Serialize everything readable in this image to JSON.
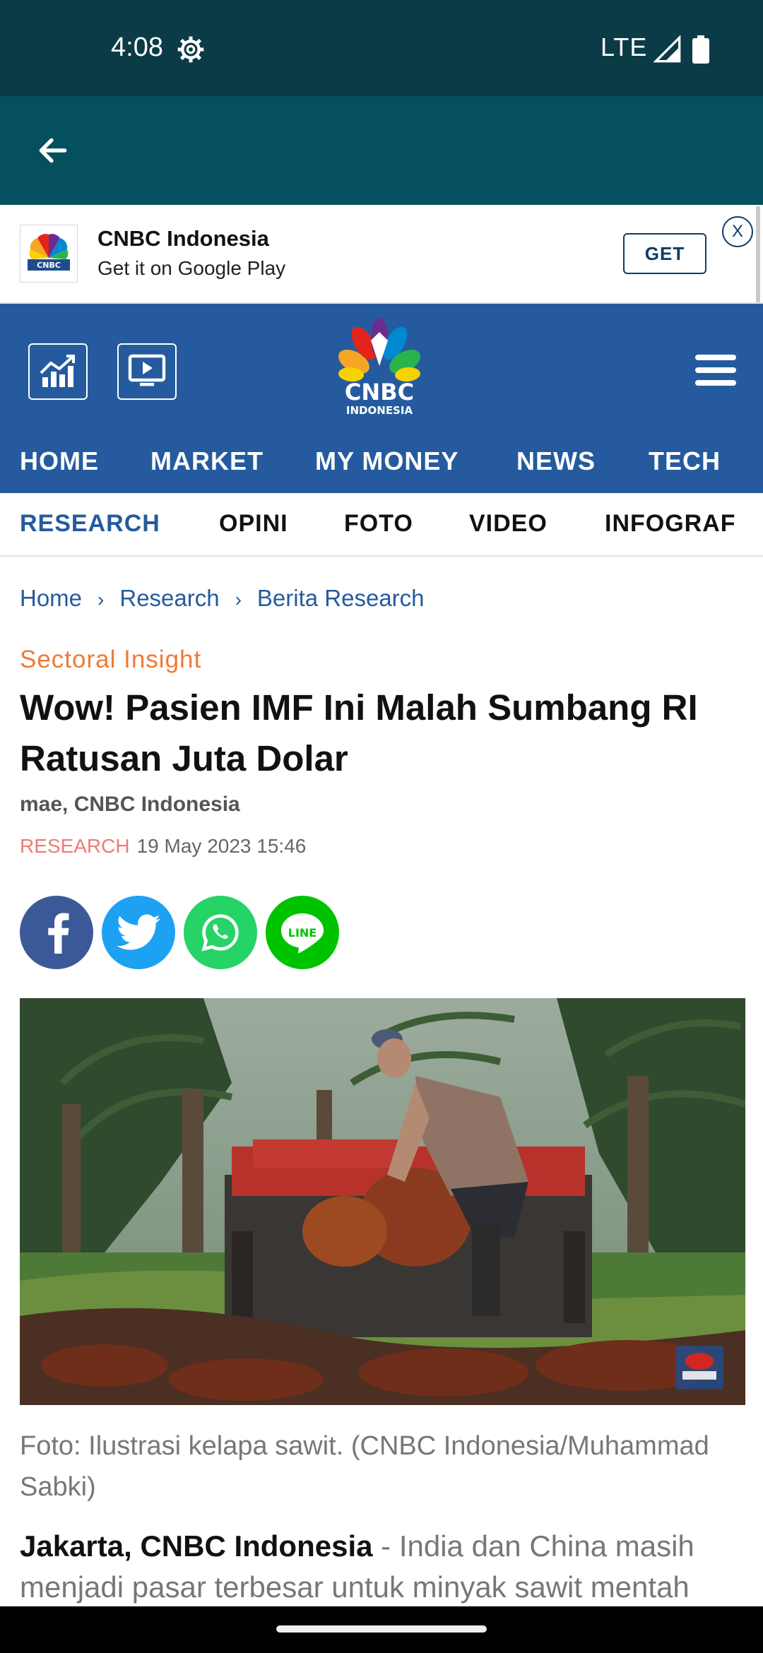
{
  "status": {
    "time": "4:08",
    "network": "LTE"
  },
  "banner": {
    "title": "CNBC Indonesia",
    "subtitle": "Get it on Google Play",
    "get_label": "GET",
    "close_label": "X"
  },
  "header": {
    "logo_text": "CNBC",
    "logo_sub": "INDONESIA"
  },
  "nav_main": [
    "HOME",
    "MARKET",
    "MY MONEY",
    "NEWS",
    "TECH"
  ],
  "nav_sub": [
    "RESEARCH",
    "OPINI",
    "FOTO",
    "VIDEO",
    "INFOGRAF"
  ],
  "breadcrumb": [
    "Home",
    "Research",
    "Berita Research"
  ],
  "article": {
    "section": "Sectoral Insight",
    "title": "Wow! Pasien IMF Ini Malah Sumbang RI Ratusan Juta Dolar",
    "author": "mae, CNBC Indonesia",
    "category": "RESEARCH",
    "date": "19 May 2023 15:46",
    "caption": "Foto: Ilustrasi kelapa sawit. (CNBC Indonesia/Muhammad Sabki)",
    "lead_bold": "Jakarta, CNBC Indonesia",
    "lead_text": " - India dan China masih menjadi pasar terbesar untuk minyak sawit mentah"
  },
  "share": {
    "line_label": "LINE"
  },
  "colors": {
    "status_bar": "#0b3b47",
    "app_bar": "#05505f",
    "brand_blue": "#255b9e",
    "accent_orange": "#f07a35",
    "facebook": "#3b5998",
    "twitter": "#1da1f2",
    "whatsapp": "#25d366",
    "line": "#00c300"
  }
}
